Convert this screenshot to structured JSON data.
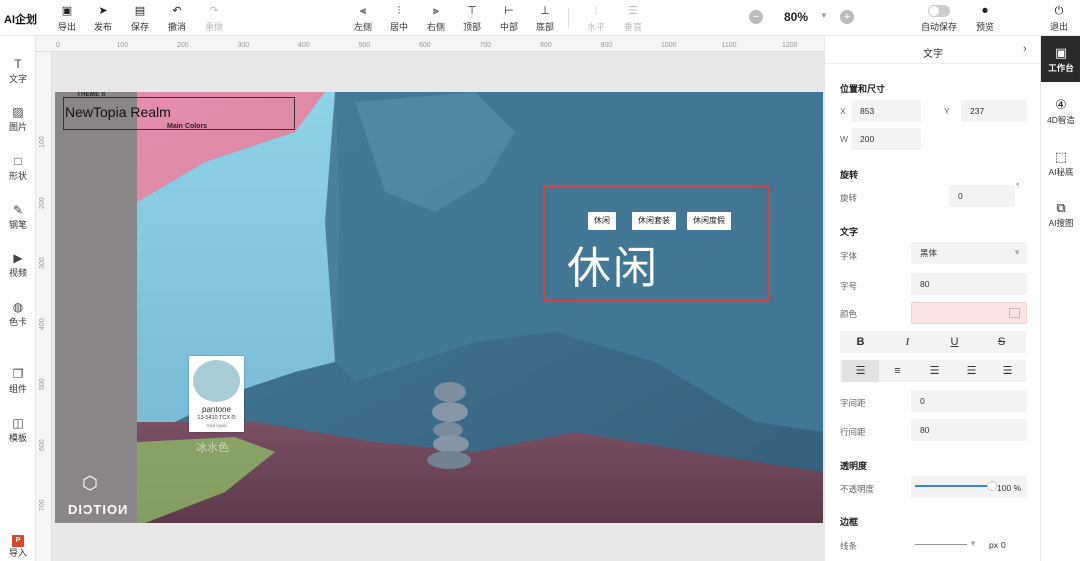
{
  "brand": "AI企划",
  "toolbar": {
    "export": "导出",
    "publish": "发布",
    "save": "保存",
    "undo": "撤消",
    "redo": "重做",
    "align_left": "左侧",
    "align_center": "居中",
    "align_right": "右侧",
    "align_top": "顶部",
    "align_middle": "中部",
    "align_bottom": "底部",
    "dist_h": "水平",
    "dist_v": "垂直",
    "zoom": "80%",
    "autosave": "自动保存",
    "preview": "预览",
    "exit": "退出"
  },
  "left_tools": {
    "text": "文字",
    "image": "图片",
    "shape": "形状",
    "pen": "钢笔",
    "video": "视频",
    "color_card": "色卡",
    "group": "组件",
    "template": "模板",
    "import": "导入",
    "import_badge": "P"
  },
  "ruler": {
    "h_ticks": [
      "0",
      "100",
      "200",
      "300",
      "400",
      "500",
      "600",
      "700",
      "800",
      "900",
      "1000",
      "1100",
      "1200"
    ],
    "v_ticks": [
      "100",
      "200",
      "300",
      "400",
      "500",
      "600",
      "700"
    ]
  },
  "slide": {
    "theme_small": "THEME II",
    "theme_title": "NewTopia Realm",
    "theme_sub": "Main Colors",
    "pantone_name": "pantone",
    "pantone_code": "13-5410 TCX ®",
    "pantone_sub": "Iced Aqua",
    "ice_label": "冰水色",
    "logo_text": "DIƆTIOИ",
    "chips": [
      "休闲",
      "休闲套装",
      "休闲度假"
    ],
    "big_text": "休闲"
  },
  "panel": {
    "title": "文字",
    "pos_size": "位置和尺寸",
    "x_label": "X",
    "x_value": "853",
    "y_label": "Y",
    "y_value": "237",
    "w_label": "W",
    "w_value": "200",
    "rotate_section": "旋转",
    "rotate_label": "旋转",
    "rotate_value": "0",
    "degree": "°",
    "text_section": "文字",
    "font_label": "字体",
    "font_value": "黑体",
    "size_label": "字号",
    "size_value": "80",
    "color_label": "颜色",
    "style_bold": "B",
    "style_italic": "I",
    "style_underline": "U",
    "style_strike": "S",
    "letter_label": "字间距",
    "letter_value": "0",
    "line_label": "行间距",
    "line_value": "80",
    "opacity_section": "透明度",
    "opacity_label": "不透明度",
    "opacity_value": "100 %",
    "opacity_fraction": 1.0,
    "border_section": "边框",
    "stroke_label": "线条",
    "stroke_unit": "px",
    "stroke_value": "0"
  },
  "rail": {
    "workbench": "工作台",
    "smart4d": "4D智造",
    "ai_matting": "AI秘底",
    "ai_search": "AI搜图"
  },
  "colors": {
    "selection": "#e03c3c",
    "accent": "#3b82f6",
    "active_rail": "#2a2a2a"
  }
}
